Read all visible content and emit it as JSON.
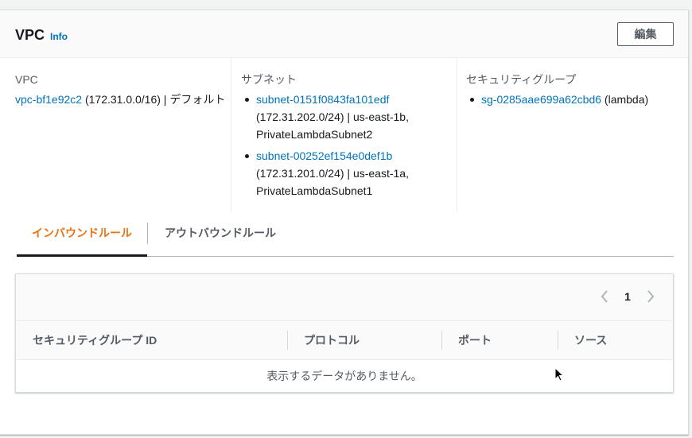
{
  "header": {
    "title": "VPC",
    "info_link": "Info",
    "edit_button": "編集"
  },
  "vpc": {
    "label": "VPC",
    "id": "vpc-bf1e92c2",
    "detail": "(172.31.0.0/16) | デフォルト"
  },
  "subnets": {
    "label": "サブネット",
    "items": [
      {
        "id": "subnet-0151f0843fa101edf",
        "detail": "(172.31.202.0/24) | us-east-1b, PrivateLambdaSubnet2"
      },
      {
        "id": "subnet-00252ef154e0def1b",
        "detail": "(172.31.201.0/24) | us-east-1a, PrivateLambdaSubnet1"
      }
    ]
  },
  "security_groups": {
    "label": "セキュリティグループ",
    "items": [
      {
        "id": "sg-0285aae699a62cbd6",
        "detail": "(lambda)"
      }
    ]
  },
  "tabs": [
    {
      "label": "インバウンドルール",
      "active": true
    },
    {
      "label": "アウトバウンドルール",
      "active": false
    }
  ],
  "table": {
    "page_number": "1",
    "columns": [
      "セキュリティグループ ID",
      "プロトコル",
      "ポート",
      "ソース"
    ],
    "empty_message": "表示するデータがありません。"
  },
  "colors": {
    "link": "#0073bb",
    "active_tab": "#ec7211",
    "text": "#16191f",
    "muted": "#545b64"
  }
}
